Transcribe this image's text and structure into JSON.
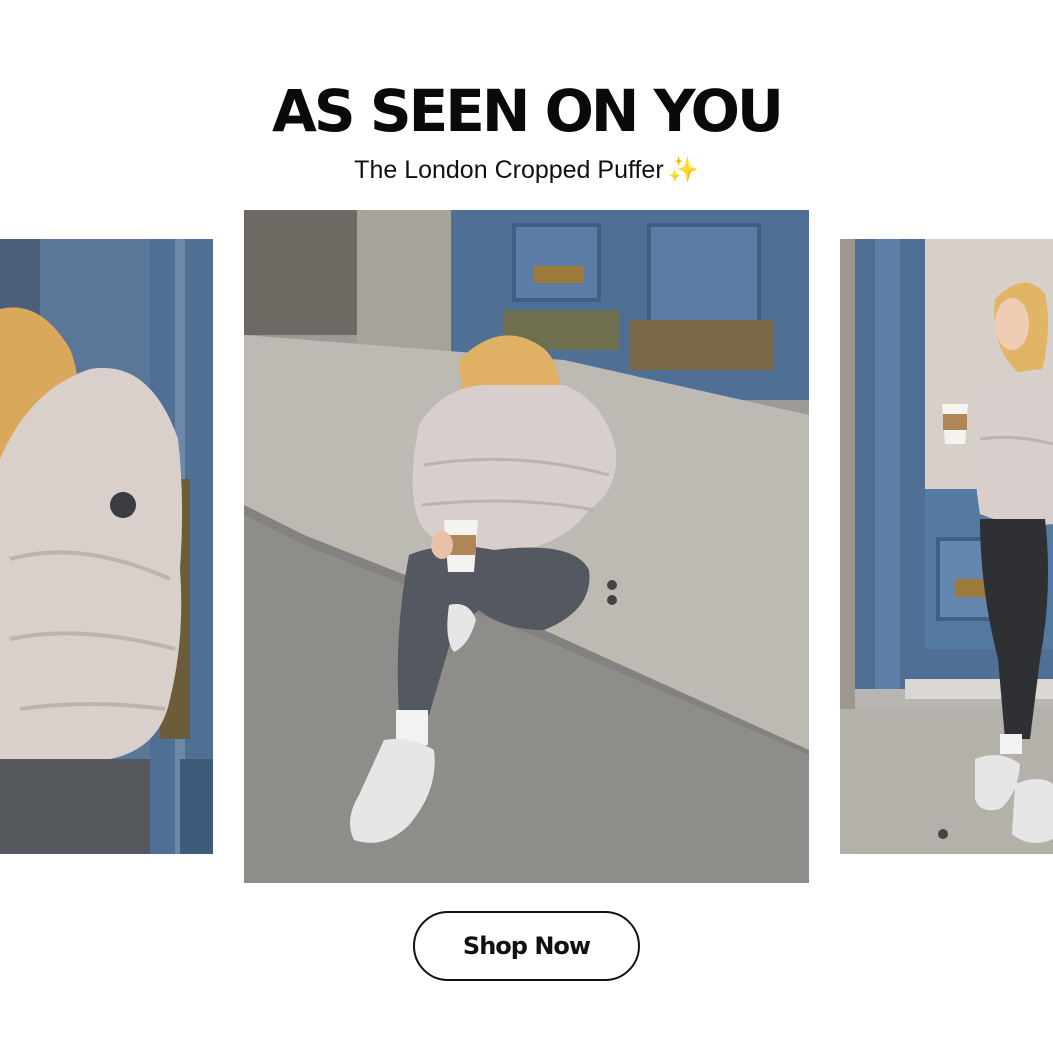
{
  "banner": {
    "headline": "AS SEEN ON YOU",
    "subheadline": "The London Cropped Puffer",
    "sparkle": "✨",
    "cta_label": "Shop Now"
  },
  "carousel": {
    "slides": [
      {
        "position": "left",
        "subject": "woman in cropped puffer jacket beside blue door"
      },
      {
        "position": "center",
        "subject": "woman sitting on curb holding coffee cup"
      },
      {
        "position": "right",
        "subject": "woman standing by blue door holding coffee cup"
      }
    ]
  },
  "colors": {
    "headline": "#0a0a0a",
    "door_blue": "#4f6f95",
    "jacket": "#d8cfcc",
    "leggings": "#555a60",
    "sidewalk": "#a9a7a3"
  }
}
